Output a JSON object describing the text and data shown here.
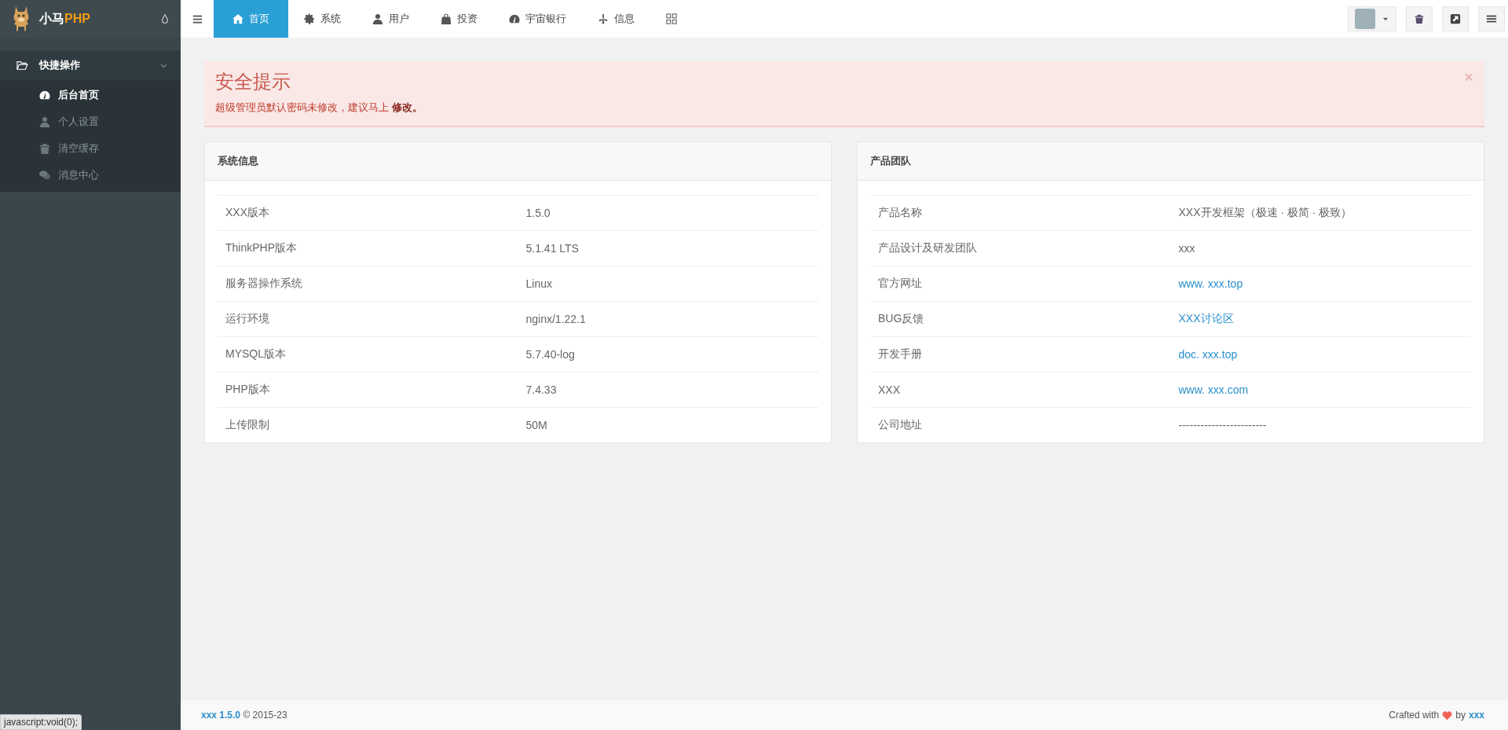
{
  "sidebar": {
    "logo": {
      "text": "小马",
      "accent": "PHP"
    },
    "menu": [
      {
        "label": "快捷操作",
        "expanded": true,
        "children": [
          {
            "label": "后台首页",
            "kind": "dashboard",
            "selected": true
          },
          {
            "label": "个人设置",
            "kind": "user",
            "selected": false
          },
          {
            "label": "清空缓存",
            "kind": "trash",
            "selected": false
          },
          {
            "label": "消息中心",
            "kind": "chat",
            "selected": false
          }
        ]
      }
    ]
  },
  "topbar": {
    "tabs": [
      {
        "label": "首页",
        "kind": "home",
        "selected": true
      },
      {
        "label": "系统",
        "kind": "gear",
        "selected": false
      },
      {
        "label": "用户",
        "kind": "user",
        "selected": false
      },
      {
        "label": "投资",
        "kind": "bag",
        "selected": false
      },
      {
        "label": "宇宙银行",
        "kind": "dashboard",
        "selected": false
      },
      {
        "label": "信息",
        "kind": "burst",
        "selected": false
      }
    ]
  },
  "alert": {
    "title": "安全提示",
    "message": "超级管理员默认密码未修改，建议马上",
    "link": "修改。",
    "close": "×"
  },
  "panels": [
    {
      "title": "系统信息",
      "rows": [
        {
          "label": "XXX版本",
          "value": "1.5.0",
          "link": false
        },
        {
          "label": "ThinkPHP版本",
          "value": "5.1.41 LTS",
          "link": false
        },
        {
          "label": "服务器操作系统",
          "value": "Linux",
          "link": false
        },
        {
          "label": "运行环境",
          "value": "nginx/1.22.1",
          "link": false
        },
        {
          "label": "MYSQL版本",
          "value": "5.7.40-log",
          "link": false
        },
        {
          "label": "PHP版本",
          "value": "7.4.33",
          "link": false
        },
        {
          "label": "上传限制",
          "value": "50M",
          "link": false
        }
      ]
    },
    {
      "title": "产品团队",
      "rows": [
        {
          "label": "产品名称",
          "value": "XXX开发框架（极速 · 极简 · 极致）",
          "link": false
        },
        {
          "label": "产品设计及研发团队",
          "value": "xxx",
          "link": false
        },
        {
          "label": "官方网址",
          "value": "www. xxx.top",
          "link": true
        },
        {
          "label": "BUG反馈",
          "value": "XXX讨论区",
          "link": true
        },
        {
          "label": "开发手册",
          "value": "doc. xxx.top",
          "link": true
        },
        {
          "label": "XXX",
          "value": "www. xxx.com",
          "link": true
        },
        {
          "label": "公司地址",
          "value": "------------------------",
          "link": false
        }
      ]
    }
  ],
  "footer": {
    "version_link": "xxx 1.5.0",
    "copyright": "© 2015-23",
    "credit_prefix": "Crafted with",
    "credit_by": "by",
    "credit_link": "xxx"
  },
  "status_tooltip": "javascript:void(0);"
}
